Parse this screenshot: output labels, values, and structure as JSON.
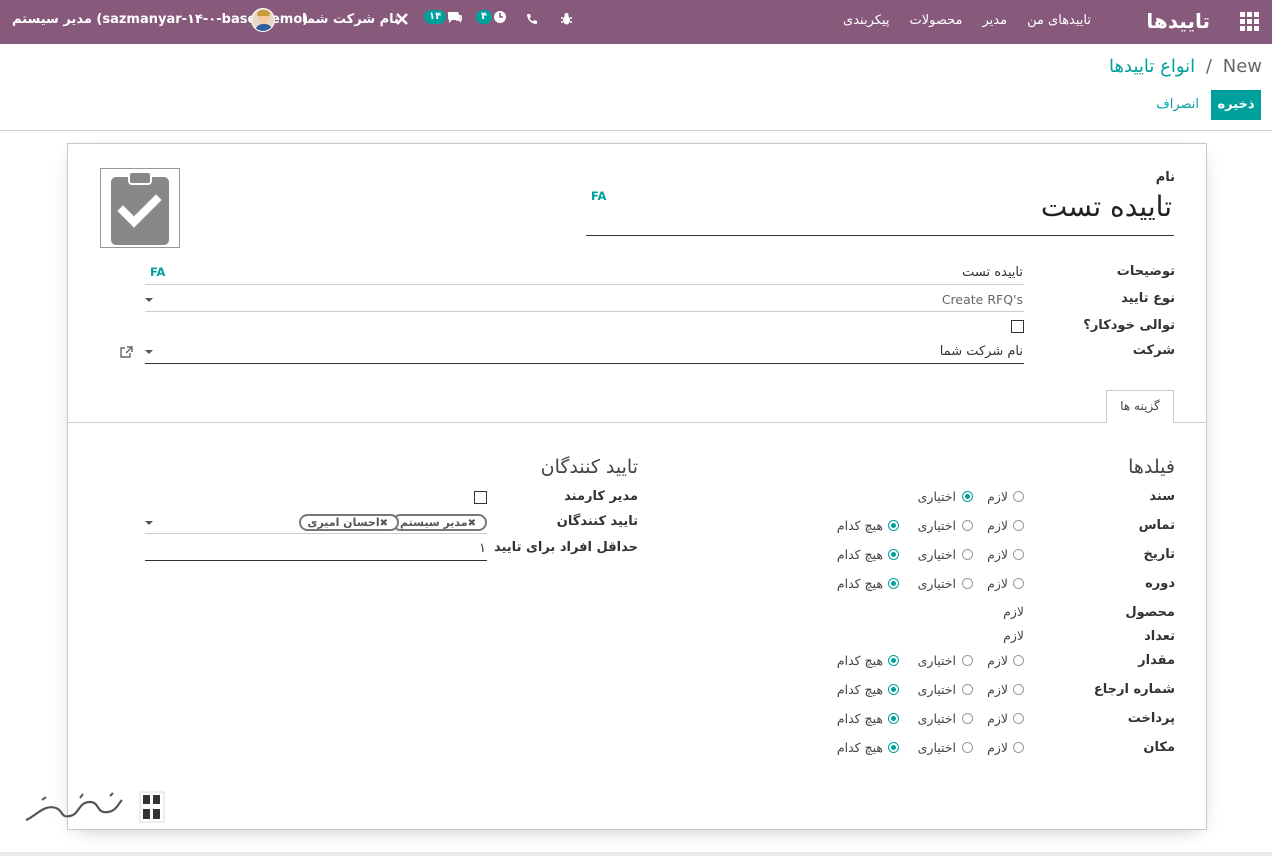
{
  "navbar": {
    "brand": "تاییدها",
    "menu": [
      "تاییدهای من",
      "مدیر",
      "محصولات",
      "پیکربندی"
    ],
    "user": "مدیر سیستم (sazmanyar-۱۴-۰-base-demo)",
    "company": "نام شرکت شما",
    "activity_count": "۴",
    "message_count": "۱۴"
  },
  "breadcrumb": {
    "parent": "انواع تاییدها",
    "sep": "/",
    "current": "New"
  },
  "buttons": {
    "save": "ذخیره",
    "discard": "انصراف"
  },
  "form": {
    "name_label": "نام",
    "name_value": "تاییده تست",
    "lang": "FA",
    "description_label": "توضیحات",
    "description_value": "تاییده تست",
    "type_label": "نوع تایید",
    "type_value": "Create RFQ's",
    "auto_seq_label": "توالی خودکار؟",
    "company_label": "شرکت",
    "company_value": "نام شرکت شما"
  },
  "tabs": [
    "گزینه ها"
  ],
  "fields_section": {
    "title": "فیلدها",
    "rows": [
      {
        "label": "سند",
        "options": [
          "لازم",
          "اختیاری"
        ],
        "selected": 1
      },
      {
        "label": "تماس",
        "options": [
          "لازم",
          "اختیاری",
          "هیچ کدام"
        ],
        "selected": 2
      },
      {
        "label": "تاریخ",
        "options": [
          "لازم",
          "اختیاری",
          "هیچ کدام"
        ],
        "selected": 2
      },
      {
        "label": "دوره",
        "options": [
          "لازم",
          "اختیاری",
          "هیچ کدام"
        ],
        "selected": 2
      },
      {
        "label": "محصول",
        "static": "لازم"
      },
      {
        "label": "تعداد",
        "static": "لازم"
      },
      {
        "label": "مقدار",
        "options": [
          "لازم",
          "اختیاری",
          "هیچ کدام"
        ],
        "selected": 2
      },
      {
        "label": "شماره ارجاع",
        "options": [
          "لازم",
          "اختیاری",
          "هیچ کدام"
        ],
        "selected": 2
      },
      {
        "label": "پرداخت",
        "options": [
          "لازم",
          "اختیاری",
          "هیچ کدام"
        ],
        "selected": 2
      },
      {
        "label": "مکان",
        "options": [
          "لازم",
          "اختیاری",
          "هیچ کدام"
        ],
        "selected": 2
      }
    ]
  },
  "approvers_section": {
    "title": "تایید کنندگان",
    "manager_label": "مدیر کارمند",
    "approvers_label": "تایید کنندگان",
    "approvers_tags": [
      "مدیر سیستم",
      "احسان امیری"
    ],
    "min_label": "حداقل افراد برای تایید",
    "min_value": "۱"
  }
}
